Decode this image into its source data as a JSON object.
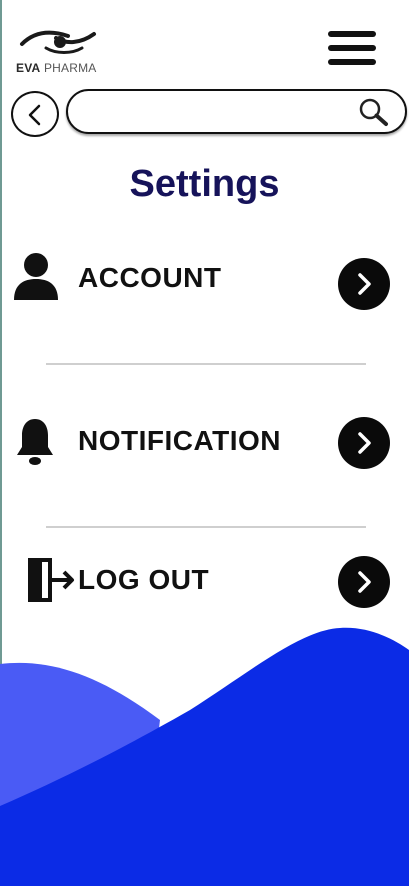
{
  "brand": {
    "name_strong": "EVA",
    "name_light": "PHARMA"
  },
  "header": {
    "menu_icon": "hamburger-menu-icon",
    "back_icon": "chevron-left-icon"
  },
  "search": {
    "value": "",
    "placeholder": "",
    "icon": "search-icon"
  },
  "page": {
    "title": "Settings"
  },
  "settings": {
    "items": [
      {
        "label": "ACCOUNT",
        "icon": "user-icon",
        "action_icon": "chevron-right-icon"
      },
      {
        "label": "NOTIFICATION",
        "icon": "bell-icon",
        "action_icon": "chevron-right-icon"
      },
      {
        "label": "LOG OUT",
        "icon": "logout-icon",
        "action_icon": "chevron-right-icon"
      }
    ]
  },
  "colors": {
    "title": "#16135a",
    "wave_front": "#0b2be6",
    "wave_back": "#4a5bf5",
    "chevron_bg": "#0a0a0a"
  }
}
